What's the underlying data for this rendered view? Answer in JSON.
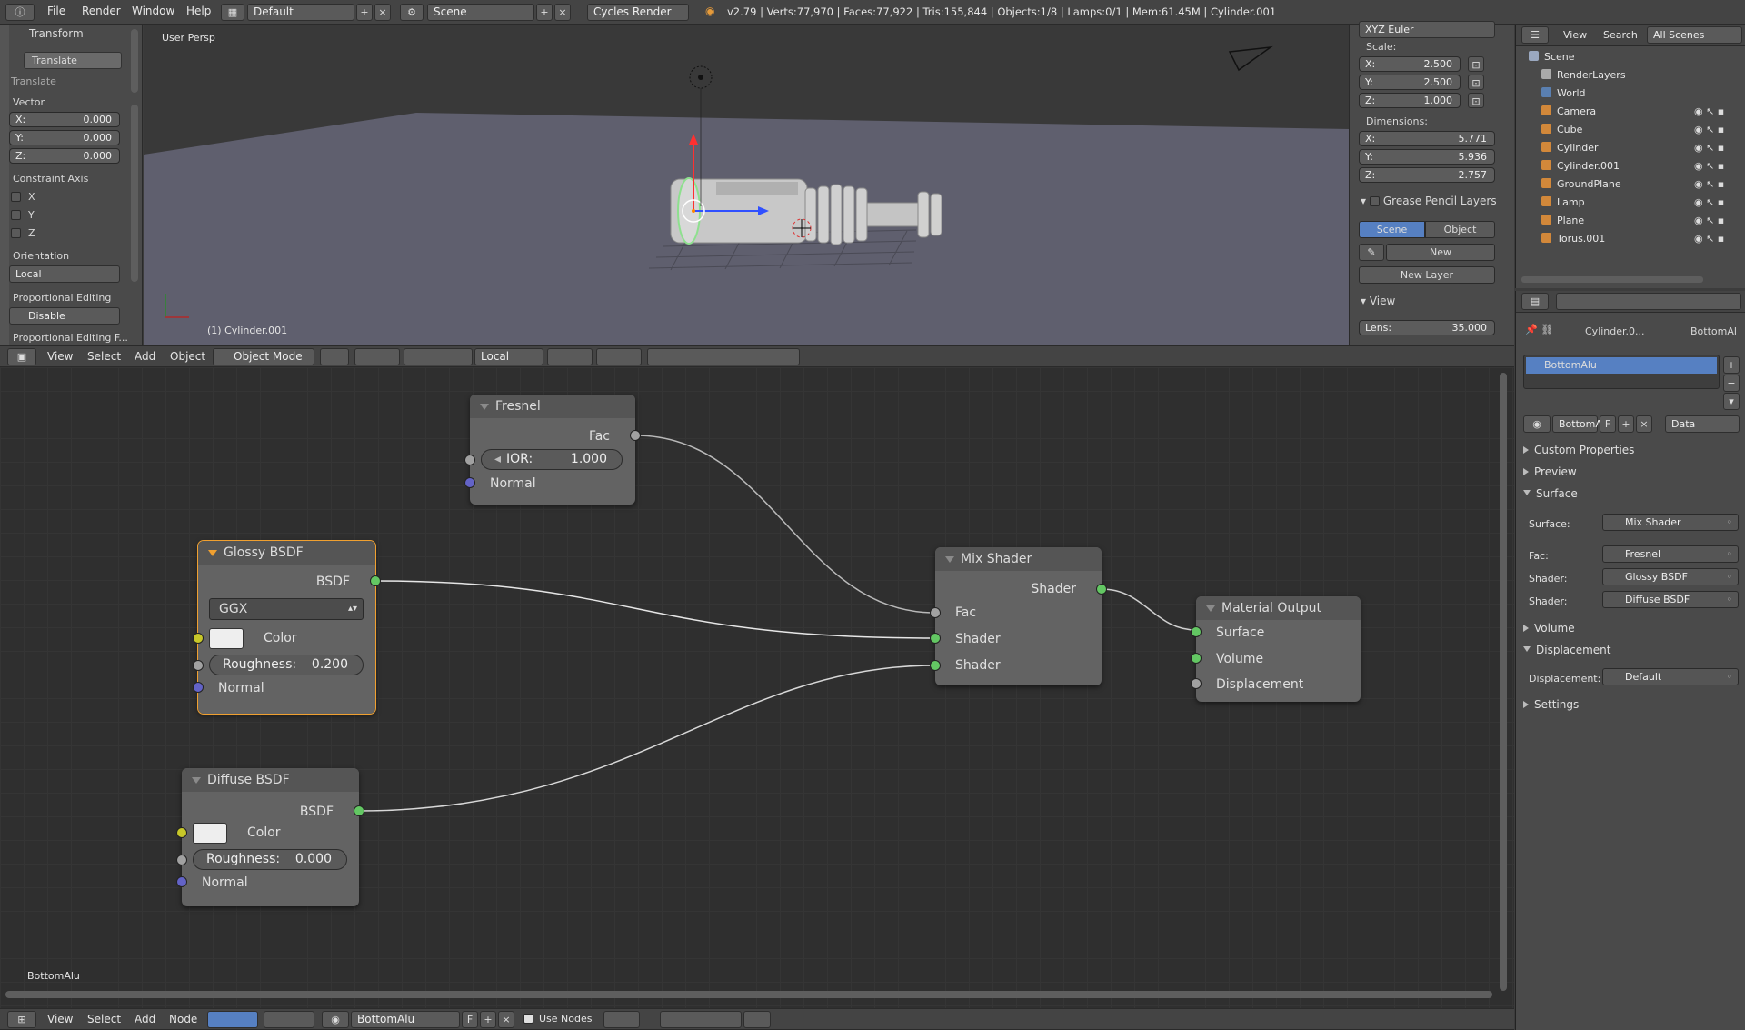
{
  "menu": {
    "file": "File",
    "render": "Render",
    "window": "Window",
    "help": "Help"
  },
  "screen_layout": "Default",
  "scene_name": "Scene",
  "render_engine": "Cycles Render",
  "status_text": "v2.79 | Verts:77,970 | Faces:77,922 | Tris:155,844 | Objects:1/8 | Lamps:0/1 | Mem:61.45M | Cylinder.001",
  "toolshelf": {
    "transform_title": "Transform",
    "translate_btn": "Translate",
    "translate_sub": "Translate",
    "vector_label": "Vector",
    "x_label": "X:",
    "x_val": "0.000",
    "y_label": "Y:",
    "y_val": "0.000",
    "z_label": "Z:",
    "z_val": "0.000",
    "constraint_label": "Constraint Axis",
    "cx": "X",
    "cy": "Y",
    "cz": "Z",
    "orientation_label": "Orientation",
    "orientation_val": "Local",
    "prop_edit_label": "Proportional Editing",
    "prop_edit_val": "Disable",
    "prop_edit_falloff": "Proportional Editing F..."
  },
  "viewport": {
    "persp_label": "User Persp",
    "object_label": "(1) Cylinder.001"
  },
  "npanel": {
    "rotation_mode": "XYZ Euler",
    "scale_label": "Scale:",
    "sx": "X:",
    "sx_val": "2.500",
    "sy": "Y:",
    "sy_val": "2.500",
    "sz": "Z:",
    "sz_val": "1.000",
    "dim_label": "Dimensions:",
    "dx": "X:",
    "dx_val": "5.771",
    "dy": "Y:",
    "dy_val": "5.936",
    "dz": "Z:",
    "dz_val": "2.757",
    "gp_title": "Grease Pencil Layers",
    "gp_scene": "Scene",
    "gp_object": "Object",
    "gp_new": "New",
    "gp_new_layer": "New Layer",
    "view_title": "View",
    "lens_label": "Lens:",
    "lens_val": "35.000"
  },
  "view3d_header": {
    "view": "View",
    "select": "Select",
    "add": "Add",
    "object": "Object",
    "mode": "Object Mode",
    "orientation": "Local"
  },
  "outliner": {
    "view": "View",
    "search": "Search",
    "filter": "All Scenes",
    "items": [
      {
        "label": "Scene",
        "color": "#9aa8c0"
      },
      {
        "label": "RenderLayers",
        "color": "#aaaaaa"
      },
      {
        "label": "World",
        "color": "#5a7fb0"
      },
      {
        "label": "Camera",
        "color": "#d2883a"
      },
      {
        "label": "Cube",
        "color": "#d2883a"
      },
      {
        "label": "Cylinder",
        "color": "#d2883a"
      },
      {
        "label": "Cylinder.001",
        "color": "#d2883a"
      },
      {
        "label": "GroundPlane",
        "color": "#d2883a"
      },
      {
        "label": "Lamp",
        "color": "#d2883a"
      },
      {
        "label": "Plane",
        "color": "#d2883a"
      },
      {
        "label": "Torus.001",
        "color": "#d2883a"
      }
    ]
  },
  "properties": {
    "breadcrumb_obj": "Cylinder.0...",
    "breadcrumb_mat": "BottomAl",
    "material_slot": "BottomAlu",
    "material_name": "BottomAl",
    "f_btn": "F",
    "link_val": "Data",
    "custom_props": "Custom Properties",
    "preview": "Preview",
    "surface": "Surface",
    "surface_label": "Surface:",
    "surface_val": "Mix Shader",
    "fac_label": "Fac:",
    "fac_val": "Fresnel",
    "shader1_label": "Shader:",
    "shader1_val": "Glossy BSDF",
    "shader2_label": "Shader:",
    "shader2_val": "Diffuse BSDF",
    "volume": "Volume",
    "displacement": "Displacement",
    "disp_label": "Displacement:",
    "disp_val": "Default",
    "settings": "Settings"
  },
  "nodes": {
    "fresnel": {
      "title": "Fresnel",
      "fac": "Fac",
      "ior_label": "IOR:",
      "ior_val": "1.000",
      "normal": "Normal"
    },
    "glossy": {
      "title": "Glossy BSDF",
      "bsdf": "BSDF",
      "dist": "GGX",
      "color": "Color",
      "rough_label": "Roughness:",
      "rough_val": "0.200",
      "normal": "Normal"
    },
    "diffuse": {
      "title": "Diffuse BSDF",
      "bsdf": "BSDF",
      "color": "Color",
      "rough_label": "Roughness:",
      "rough_val": "0.000",
      "normal": "Normal"
    },
    "mix": {
      "title": "Mix Shader",
      "shader_out": "Shader",
      "fac": "Fac",
      "shader1": "Shader",
      "shader2": "Shader"
    },
    "output": {
      "title": "Material Output",
      "surface": "Surface",
      "volume": "Volume",
      "displacement": "Displacement"
    }
  },
  "node_editor": {
    "material_label": "BottomAlu"
  },
  "node_header": {
    "view": "View",
    "select": "Select",
    "add": "Add",
    "node": "Node",
    "material": "BottomAlu",
    "f_btn": "F",
    "use_nodes": "Use Nodes"
  },
  "colors": {
    "shader_socket": "#63c763",
    "color_socket": "#c7c729",
    "float_socket": "#a1a1a1",
    "vector_socket": "#6363c7",
    "selected": "#f0a030"
  }
}
